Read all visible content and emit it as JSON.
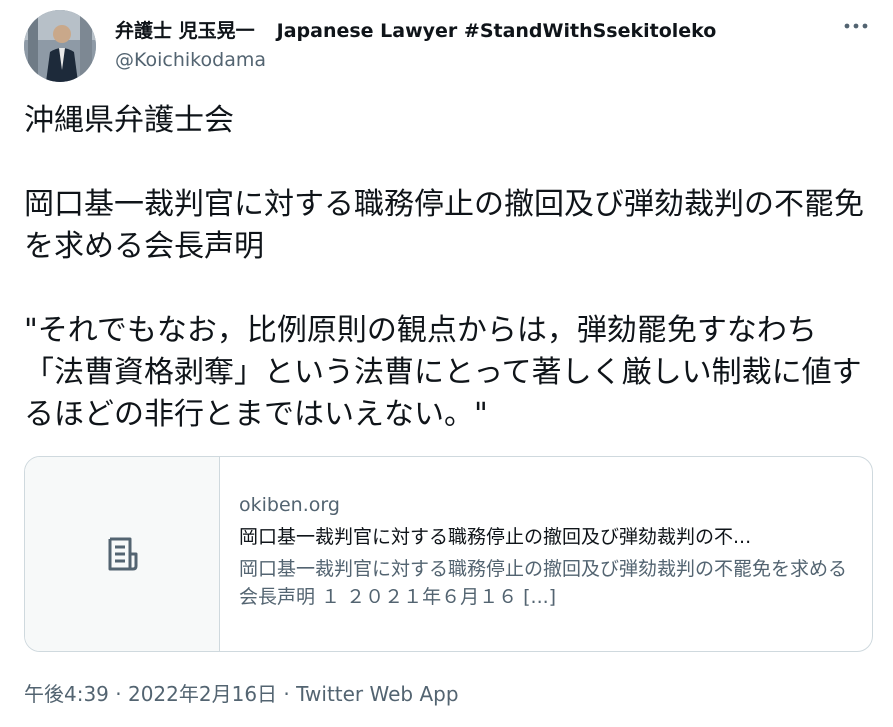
{
  "tweet": {
    "display_name": "弁護士 児玉晃一",
    "display_name_extra": "Japanese Lawyer #StandWithSsekitoleko",
    "handle": "@Koichikodama",
    "text": "沖縄県弁護士会\n\n岡口基一裁判官に対する職務停止の撤回及び弾劾裁判の不罷免を求める会長声明\n\n\"それでもなお，比例原則の観点からは，弾劾罷免すなわち「法曹資格剥奪」という法曹にとって著しく厳しい制裁に値するほどの非行とまではいえない。\"",
    "card": {
      "domain": "okiben.org",
      "title": "岡口基一裁判官に対する職務停止の撤回及び弾劾裁判の不...",
      "description": "岡口基一裁判官に対する職務停止の撤回及び弾劾裁判の不罷免を求める会長声明 １ ２０２１年６月１６ [...]",
      "thumb_icon": "document-icon"
    },
    "meta": "午後4:39 · 2022年2月16日 · Twitter Web App"
  },
  "icons": {
    "more": "more-horizontal-icon",
    "avatar": "avatar"
  },
  "colors": {
    "text_primary": "#0f1419",
    "text_secondary": "#536471",
    "border": "#cfd9de"
  }
}
